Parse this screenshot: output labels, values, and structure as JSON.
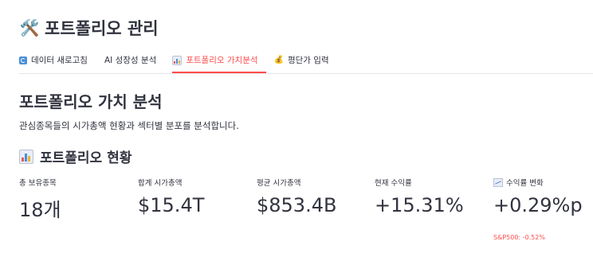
{
  "title": {
    "icon": "hammer-and-wrench-icon",
    "glyph": "🛠️",
    "text": "포트폴리오 관리"
  },
  "tabs": [
    {
      "icon": "refresh-icon",
      "label": "데이터 새로고침",
      "active": false
    },
    {
      "icon": "ai-icon",
      "label": "AI 성장성 분석",
      "active": false
    },
    {
      "icon": "bar-chart-icon",
      "label": "포트폴리오 가치분석",
      "active": true
    },
    {
      "icon": "money-bag-icon",
      "label": "평단가 입력",
      "active": false
    }
  ],
  "section": {
    "title": "포트폴리오 가치 분석",
    "description": "관심종목들의 시가총액 현황과 섹터별 분포를 분석합니다.",
    "subtitle_icon": "bar-chart-icon",
    "subtitle": "포트폴리오 현황"
  },
  "metrics": [
    {
      "label": "총 보유종목",
      "value": "18개"
    },
    {
      "label": "합계 시가총액",
      "value": "$15.4T"
    },
    {
      "label": "평균 시가총액",
      "value": "$853.4B"
    },
    {
      "label": "현재 수익률",
      "value": "+15.31%"
    },
    {
      "label_icon": "trend-chart-icon",
      "label": "수익률 변화",
      "value": "+0.29%p",
      "delta": "S&P500: -0.52%"
    }
  ],
  "colors": {
    "accent": "#ff4b4b",
    "text": "#31333f",
    "divider": "#e6e6ea"
  }
}
